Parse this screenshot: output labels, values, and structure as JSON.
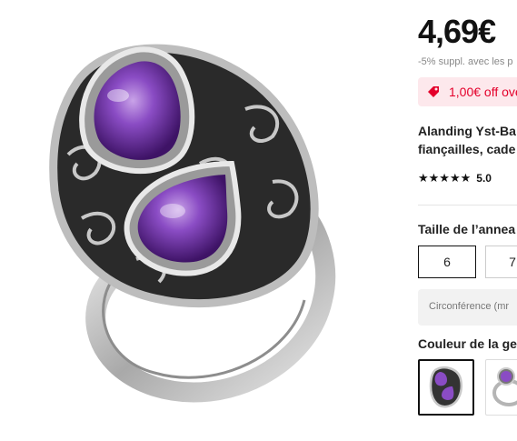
{
  "product": {
    "image": "amethyst-ring-photo",
    "price": "4,69€",
    "extra_discount": "-5% suppl. avec les p",
    "coupon": {
      "icon": "tag-icon",
      "text": "1,00€ off ove",
      "color": "#e4002b"
    },
    "title_line1": "Alanding Yst-Ba",
    "title_line2": "fiançailles, cade",
    "rating": {
      "stars": "★★★★★",
      "value": "5.0"
    }
  },
  "size": {
    "label": "Taille de l’annea",
    "options": [
      "6",
      "7"
    ],
    "selected": "6",
    "circumference": "Circonférence (mr"
  },
  "color": {
    "label": "Couleur de la ge",
    "options": [
      "amethyst-ring-thumb-1",
      "amethyst-ring-thumb-2"
    ]
  }
}
